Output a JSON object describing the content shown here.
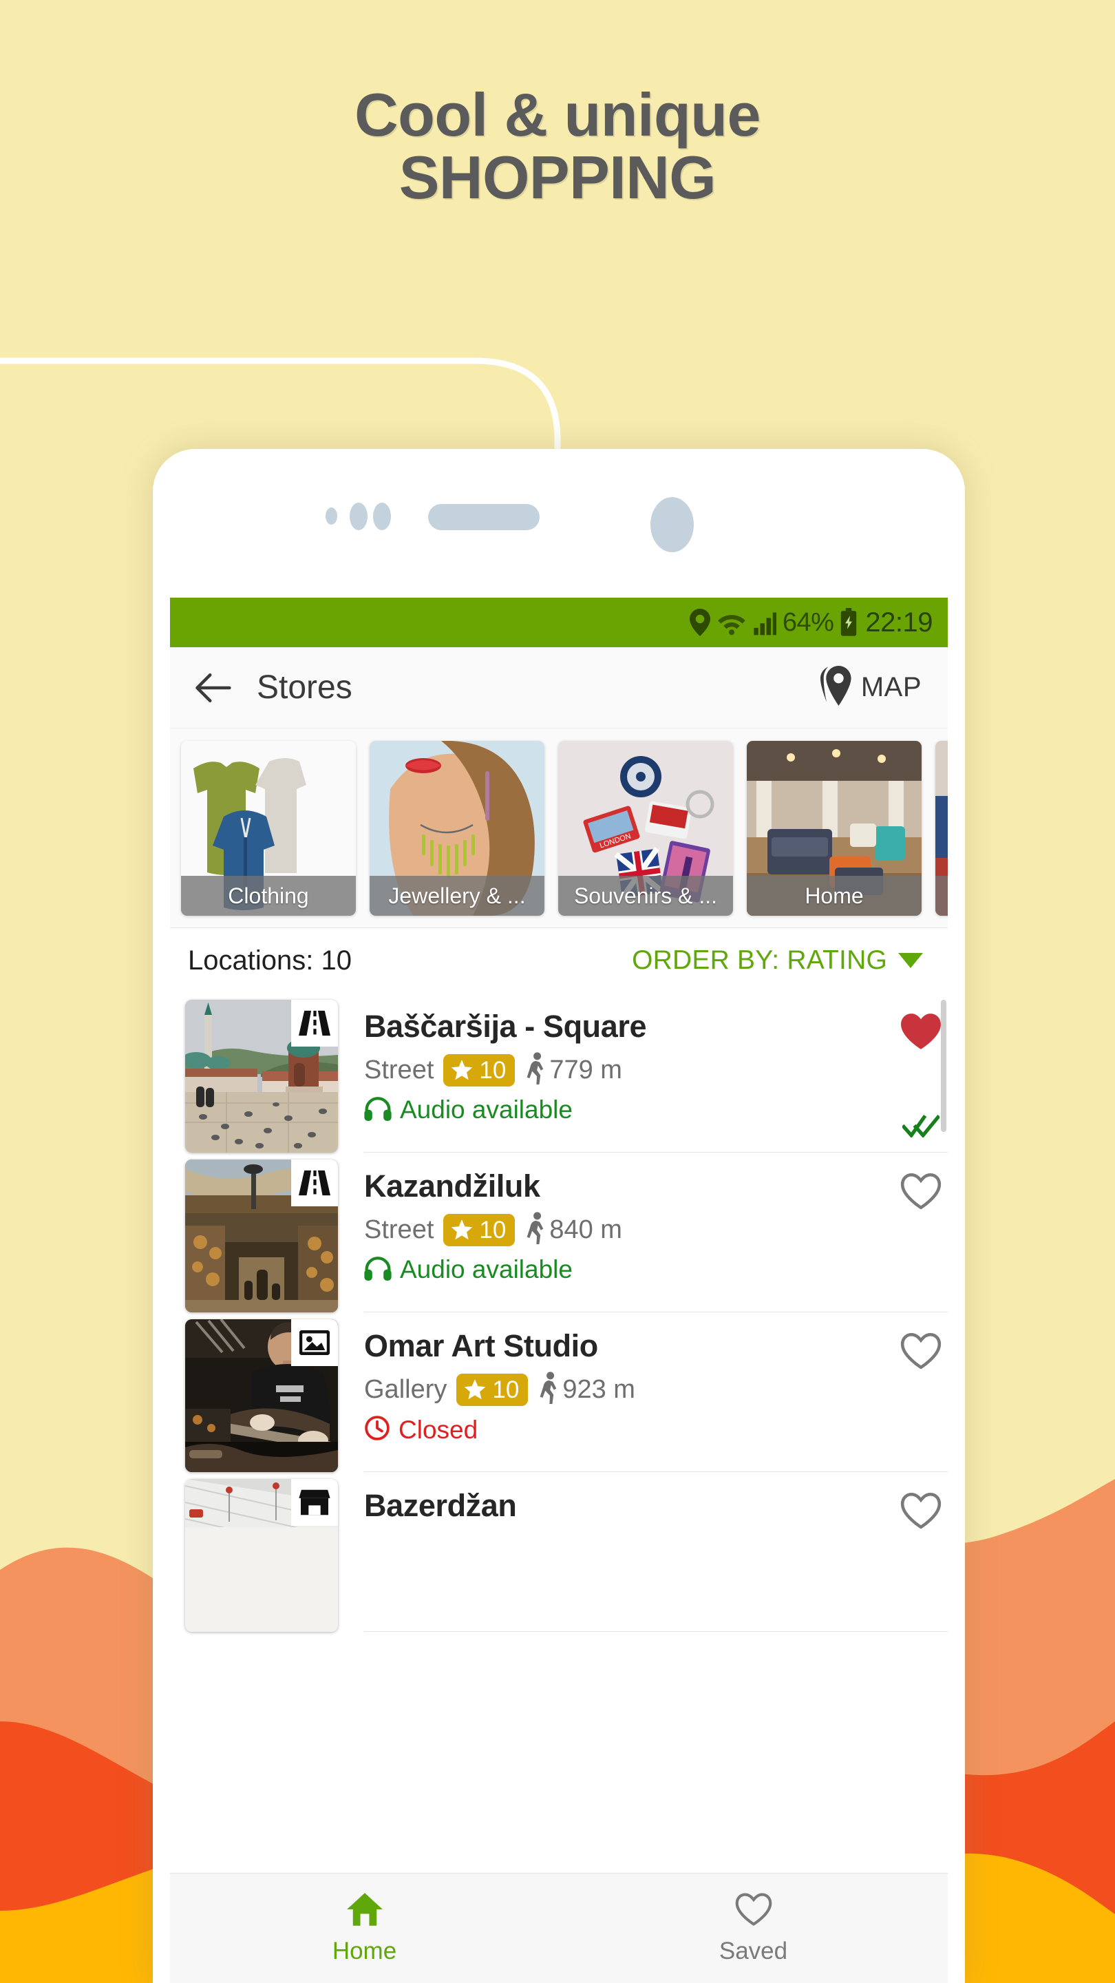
{
  "promo": {
    "headline_line1": "Cool & unique",
    "headline_line2": "SHOPPING",
    "background_color": "#F7EBAE",
    "headline_color": "#5B5B5B",
    "wave_colors": [
      "#F4935E",
      "#F24E1E",
      "#FFB703"
    ]
  },
  "status_bar": {
    "background_color": "#6AA403",
    "location_icon": "location-pin-icon",
    "wifi_icon": "wifi-icon",
    "signal_icon": "cellular-signal-icon",
    "battery_percent": "64%",
    "battery_icon": "battery-charging-icon",
    "time": "22:19"
  },
  "app_bar": {
    "back_icon": "back-arrow-icon",
    "title": "Stores",
    "map_icon": "map-pin-icon",
    "map_label": "MAP"
  },
  "categories": [
    {
      "label": "Clothing",
      "icon": "clothing-thumbnail"
    },
    {
      "label": "Jewellery & ...",
      "icon": "jewellery-thumbnail"
    },
    {
      "label": "Souvenirs & ...",
      "icon": "souvenirs-thumbnail"
    },
    {
      "label": "Home",
      "icon": "home-goods-thumbnail"
    },
    {
      "label": "",
      "icon": "partial-thumbnail"
    }
  ],
  "list_header": {
    "locations_label": "Locations: 10",
    "order_by_label": "ORDER BY: RATING",
    "caret_icon": "chevron-down-icon",
    "accent_color": "#5FA70B"
  },
  "locations": [
    {
      "name": "Baščaršija - Square",
      "type": "Street",
      "rating": "10",
      "distance": "779 m",
      "status_text": "Audio available",
      "status_kind": "audio",
      "badge_icon": "street-icon",
      "favorite": true,
      "visited": true
    },
    {
      "name": "Kazandžiluk",
      "type": "Street",
      "rating": "10",
      "distance": "840 m",
      "status_text": "Audio available",
      "status_kind": "audio",
      "badge_icon": "street-icon",
      "favorite": false,
      "visited": false
    },
    {
      "name": "Omar Art Studio",
      "type": "Gallery",
      "rating": "10",
      "distance": "923 m",
      "status_text": "Closed",
      "status_kind": "closed",
      "badge_icon": "gallery-icon",
      "favorite": false,
      "visited": false
    },
    {
      "name": "Bazerdžan",
      "type": "",
      "rating": "",
      "distance": "",
      "status_text": "",
      "status_kind": "none",
      "badge_icon": "store-icon",
      "favorite": false,
      "visited": false
    }
  ],
  "bottom_nav": [
    {
      "label": "Home",
      "icon": "home-icon",
      "active": true
    },
    {
      "label": "Saved",
      "icon": "heart-outline-icon",
      "active": false
    }
  ]
}
